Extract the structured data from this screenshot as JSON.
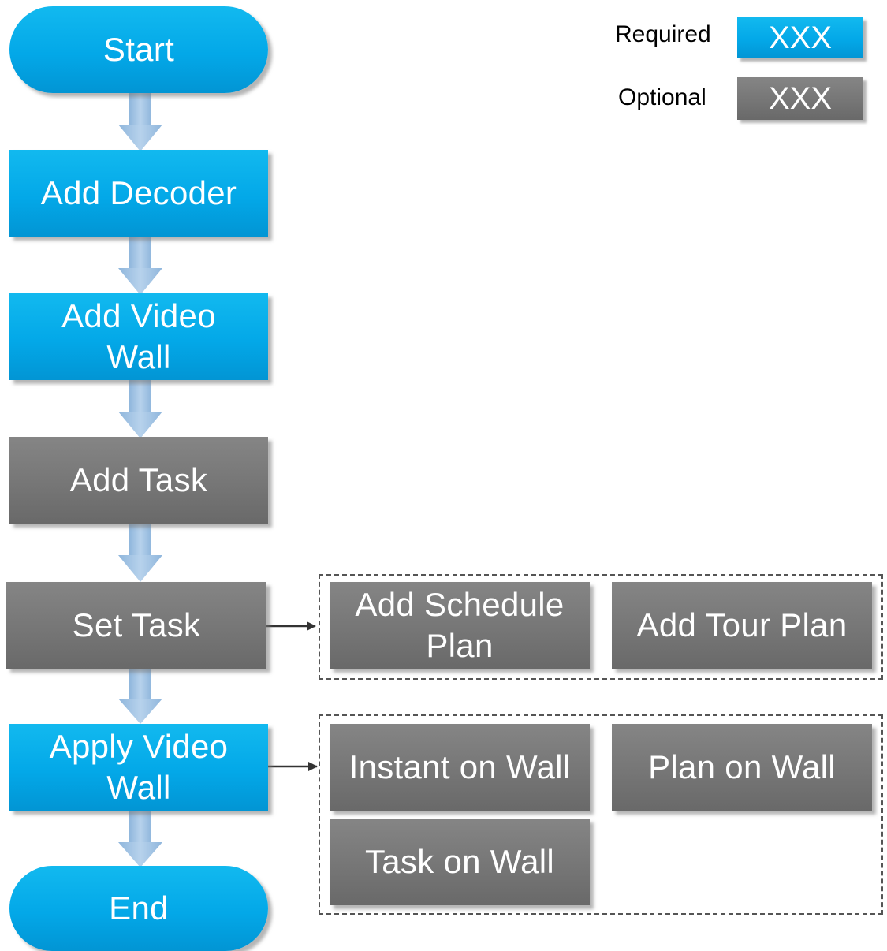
{
  "legend": {
    "required_label": "Required",
    "required_box": "XXX",
    "optional_label": "Optional",
    "optional_box": "XXX",
    "required_color": "#03a8e8",
    "optional_color": "#767676"
  },
  "flow": {
    "start": "Start",
    "add_decoder": "Add Decoder",
    "add_video_wall": "Add Video\nWall",
    "add_task": "Add Task",
    "set_task": "Set Task",
    "apply_video_wall": "Apply Video\nWall",
    "end": "End"
  },
  "set_task_options": {
    "add_schedule_plan": "Add Schedule\nPlan",
    "add_tour_plan": "Add Tour Plan"
  },
  "apply_options": {
    "instant_on_wall": "Instant on Wall",
    "plan_on_wall": "Plan on Wall",
    "task_on_wall": "Task on Wall"
  },
  "colors": {
    "arrow_fill": "#9dc3e6",
    "connector_arrow": "#333333"
  }
}
